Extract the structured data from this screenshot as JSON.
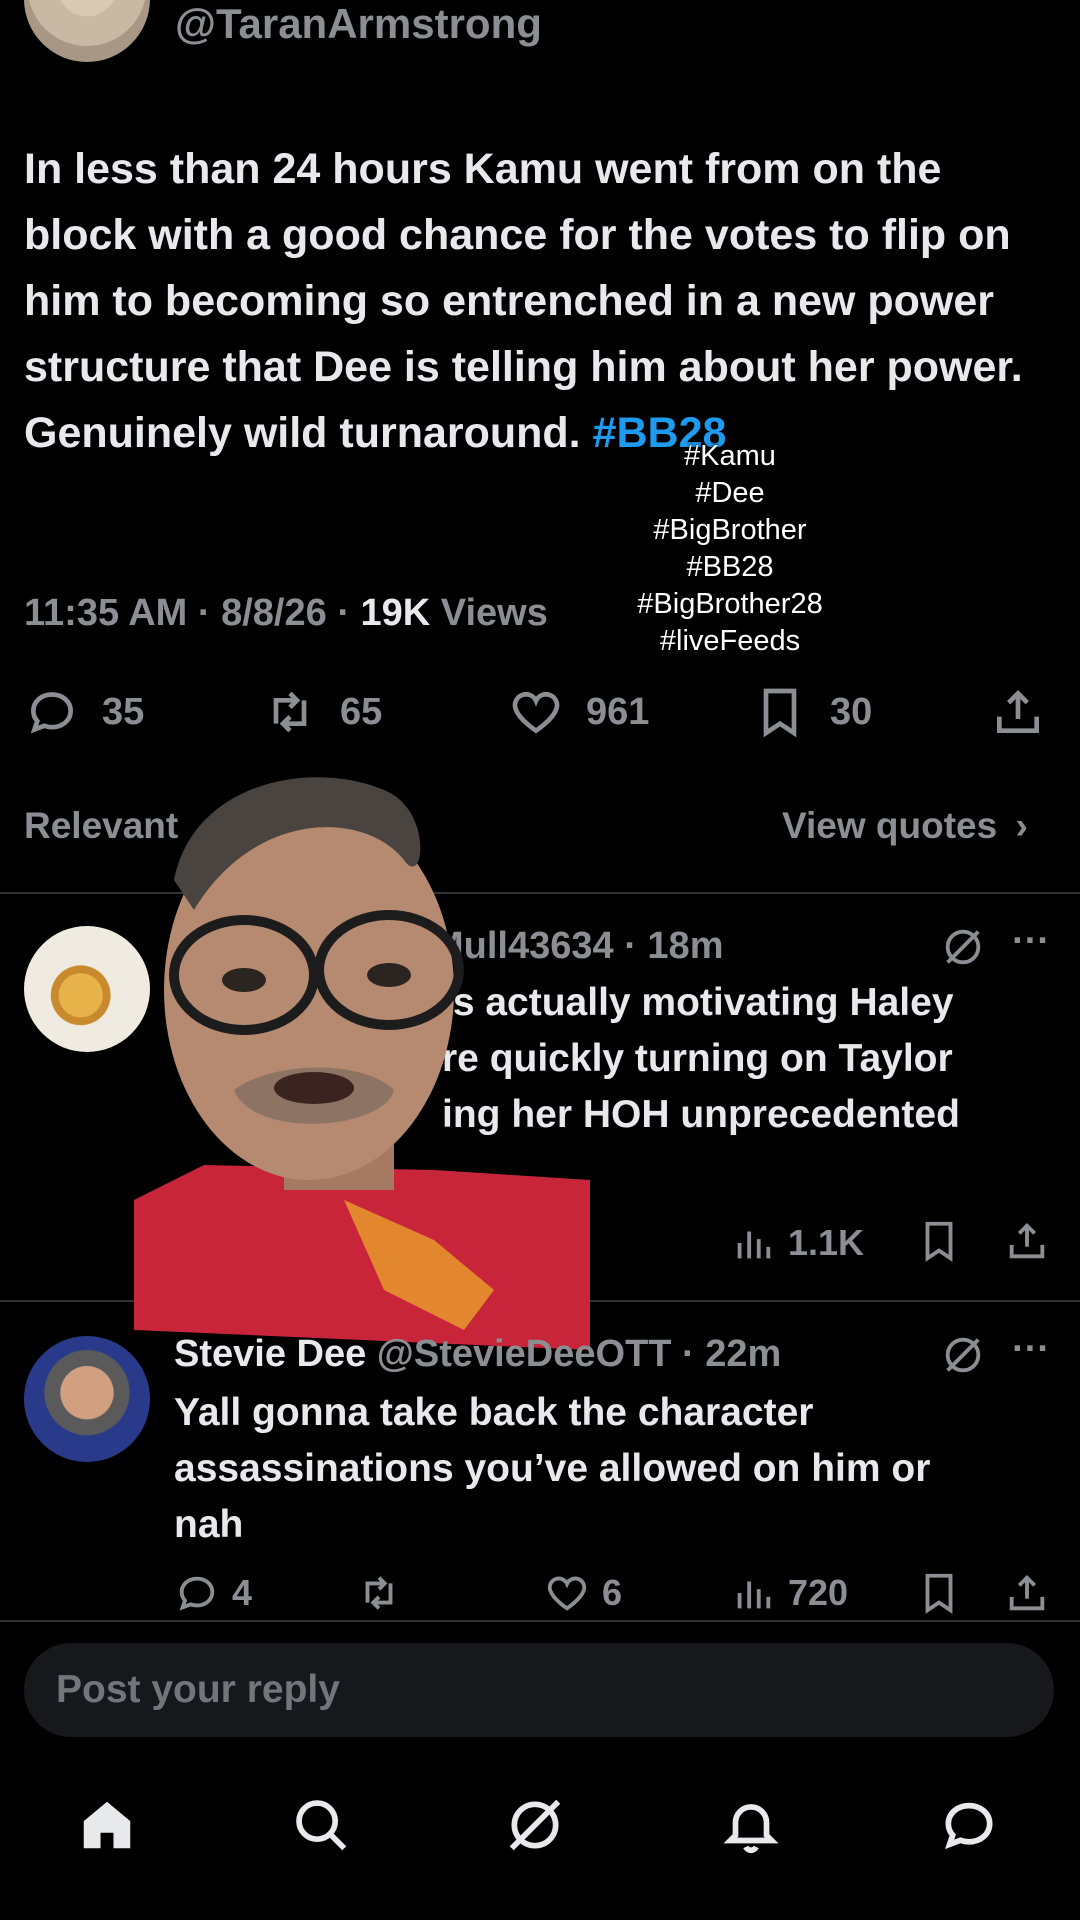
{
  "post": {
    "handle": "@TaranArmstrong",
    "text": "In less than 24 hours Kamu went from on the block with a good chance for the votes to flip on him to becoming so entrenched in a new power structure that Dee is telling him about her power. Genuinely wild turnaround. ",
    "hashtag": "#BB28",
    "time": "11:35 AM · 8/8/26 · ",
    "views_count": "19K",
    "views_label": " Views",
    "stats": {
      "replies": "35",
      "reposts": "65",
      "likes": "961",
      "bookmarks": "30"
    }
  },
  "overlay_tags": [
    "#Kamu",
    "#Dee",
    "#BigBrother",
    "#BB28",
    "#BigBrother28",
    "#liveFeeds"
  ],
  "section": {
    "left_label": "Relevant",
    "right_label": "View quotes"
  },
  "replies": [
    {
      "handle_meta": "Mull43634 · 18m",
      "lines": [
        "is actually motivating Haley",
        "re quickly turning on Taylor",
        "ing her HOH unprecedented"
      ],
      "stats": {
        "views": "1.1K"
      }
    },
    {
      "name": "Stevie Dee",
      "handle_meta": "@StevieDeeOTT · 22m",
      "lines": [
        "Yall gonna take back the character",
        "assassinations you’ve allowed on him or",
        "nah"
      ],
      "stats": {
        "replies": "4",
        "likes": "6",
        "views": "720"
      }
    }
  ],
  "reply_box": {
    "placeholder": "Post your reply"
  },
  "bottom_nav": [
    "home-icon",
    "search-icon",
    "grok-icon",
    "bell-icon",
    "messages-icon"
  ],
  "colors": {
    "accent": "#1d9bf0",
    "background": "#000000",
    "muted": "#8b8f94"
  }
}
